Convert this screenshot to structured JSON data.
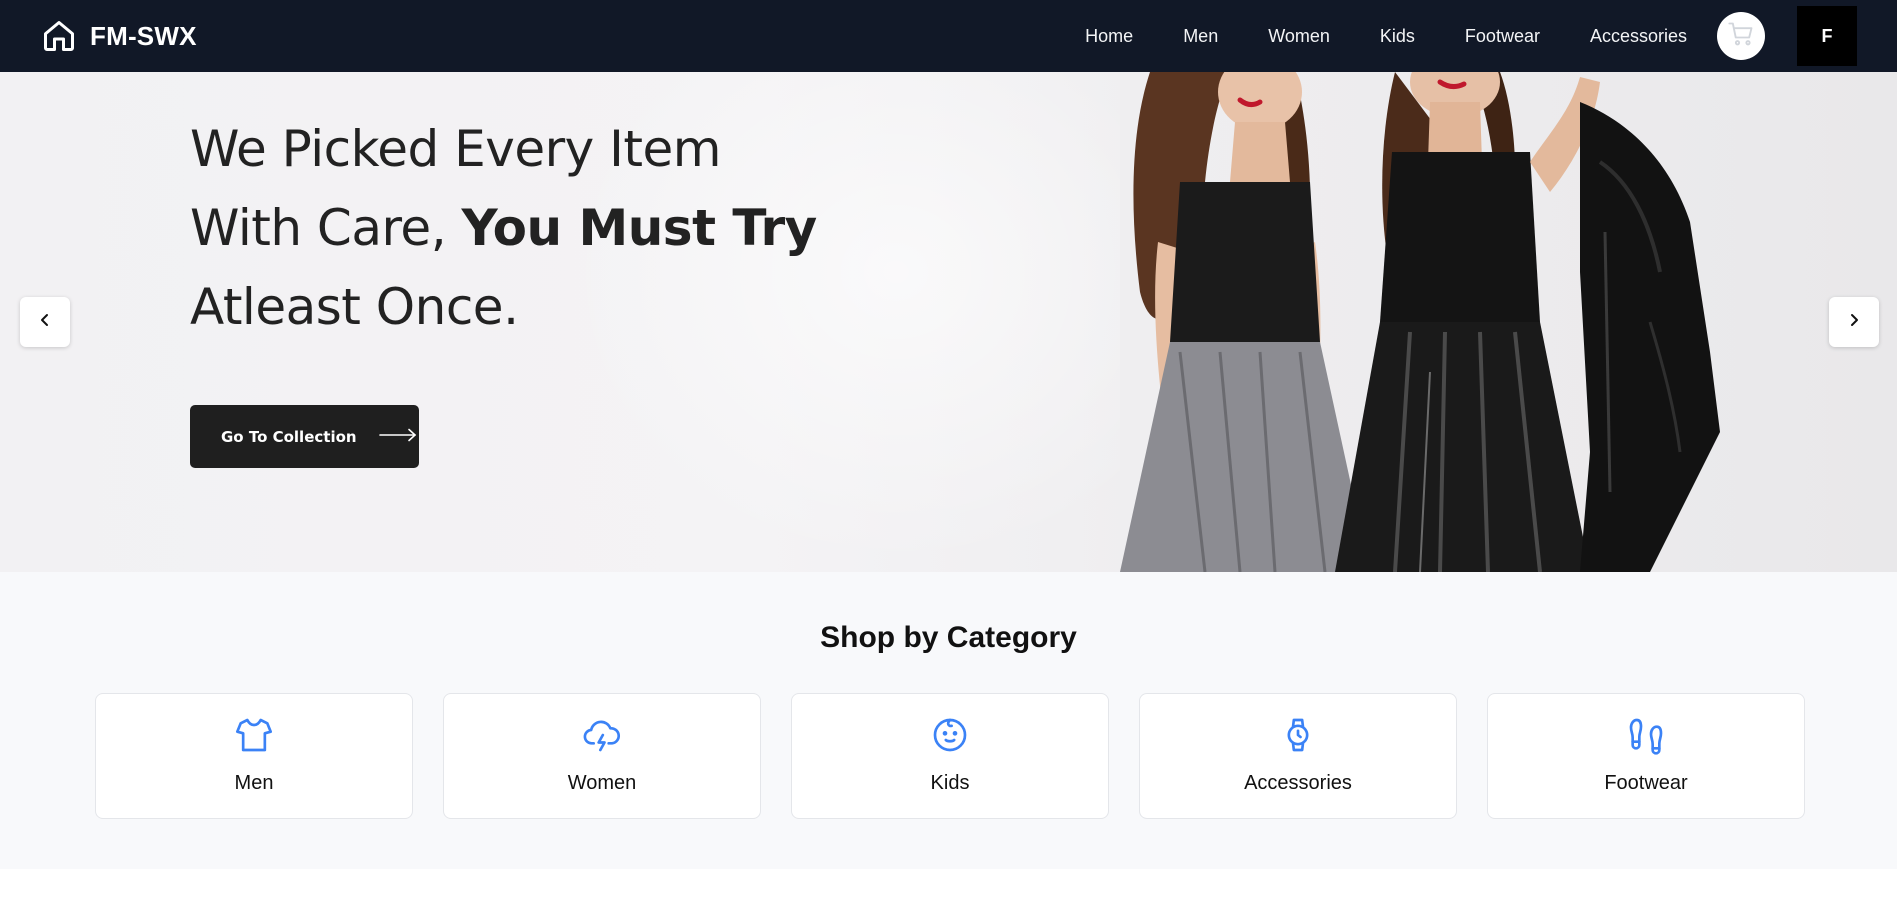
{
  "brand": {
    "name": "FM-SWX",
    "icon": "home-icon"
  },
  "nav": {
    "links": [
      "Home",
      "Men",
      "Women",
      "Kids",
      "Footwear",
      "Accessories"
    ],
    "cart_icon": "cart-icon",
    "avatar_letter": "F"
  },
  "hero": {
    "title_line1": "We Picked Every Item",
    "title_line2_plain": "With Care, ",
    "title_line2_bold": "You Must Try",
    "title_line3": "Atleast Once.",
    "cta_label": "Go To Collection",
    "cta_icon": "arrow-right-icon",
    "prev_icon": "chevron-left-icon",
    "next_icon": "chevron-right-icon"
  },
  "categories": {
    "title": "Shop by Category",
    "items": [
      {
        "label": "Men",
        "icon": "tshirt-icon"
      },
      {
        "label": "Women",
        "icon": "cloud-bolt-icon"
      },
      {
        "label": "Kids",
        "icon": "baby-face-icon"
      },
      {
        "label": "Accessories",
        "icon": "watch-icon"
      },
      {
        "label": "Footwear",
        "icon": "footprints-icon"
      }
    ]
  },
  "colors": {
    "nav_bg": "#111827",
    "accent_icon": "#3b82f6",
    "cta_bg": "#1f1f1f",
    "section_bg": "#f8f9fb"
  }
}
